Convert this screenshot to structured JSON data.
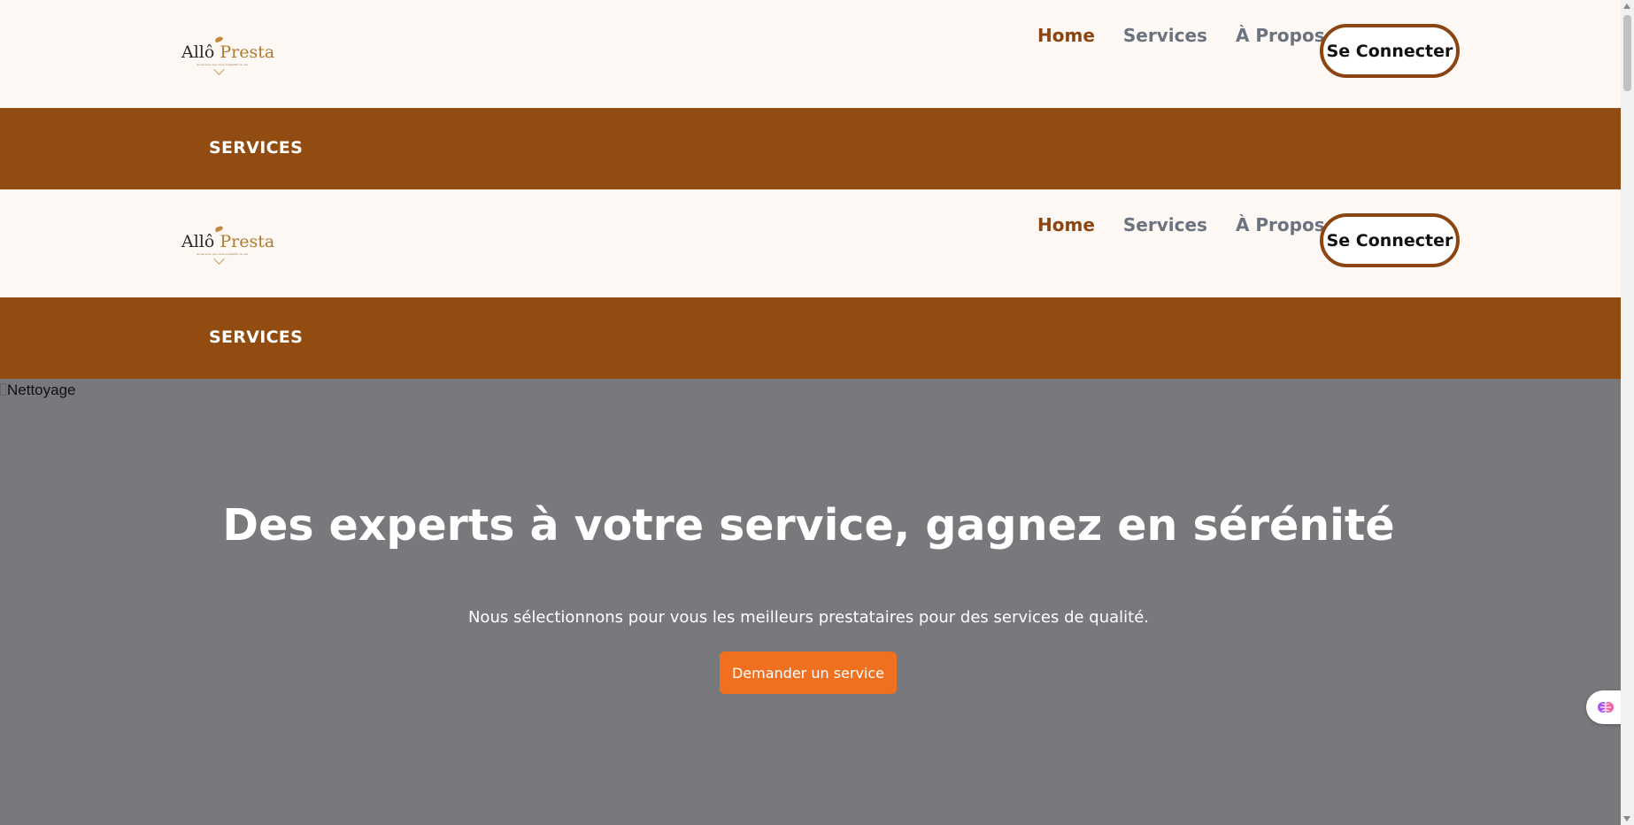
{
  "logo": {
    "brand_first": "Allô",
    "brand_second": "Presta",
    "tagline": "le service qui vous simplifie la vie"
  },
  "nav": {
    "home": "Home",
    "services": "Services",
    "about": "À Propos"
  },
  "auth": {
    "connect_label": "Se Connecter"
  },
  "section_band": {
    "label": "SERVICES"
  },
  "hero": {
    "image_alt": "Nettoyage",
    "headline": "Des experts à votre service, gagnez en sérénité",
    "subtitle": "Nous sélectionnons pour vous les meilleurs prestataires pour des services de qualité.",
    "cta_label": "Demander un service"
  },
  "colors": {
    "brand_brown": "#924b11",
    "accent_orange": "#f07020",
    "nav_active": "#8b4513",
    "nav_inactive": "#6b7280",
    "background": "#fdf8f3",
    "hero_overlay": "#78797c"
  },
  "icons": {
    "floating_widget": "brain-icon",
    "broken_image": "broken-image-icon"
  }
}
